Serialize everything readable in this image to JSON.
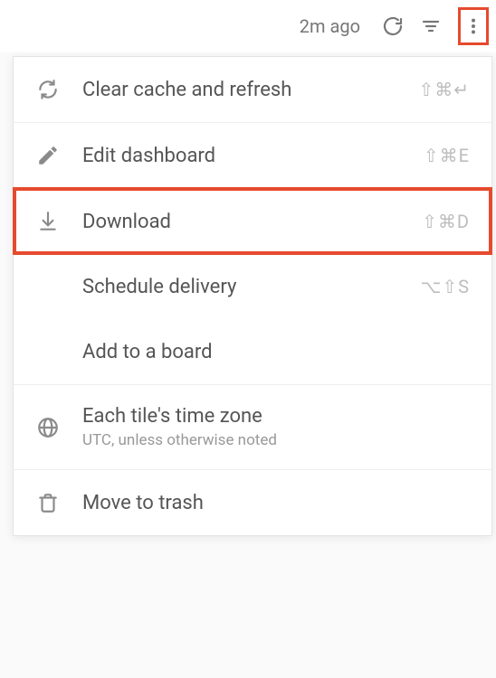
{
  "toolbar": {
    "timestamp": "2m ago"
  },
  "menu": {
    "clear_cache": {
      "label": "Clear cache and refresh",
      "shortcut": "⇧⌘↵"
    },
    "edit_dashboard": {
      "label": "Edit dashboard",
      "shortcut": "⇧⌘E"
    },
    "download": {
      "label": "Download",
      "shortcut": "⇧⌘D"
    },
    "schedule_delivery": {
      "label": "Schedule delivery",
      "shortcut": "⌥⇧S"
    },
    "add_to_board": {
      "label": "Add to a board"
    },
    "time_zone": {
      "label": "Each tile's time zone",
      "sub": "UTC, unless otherwise noted"
    },
    "move_to_trash": {
      "label": "Move to trash"
    }
  }
}
